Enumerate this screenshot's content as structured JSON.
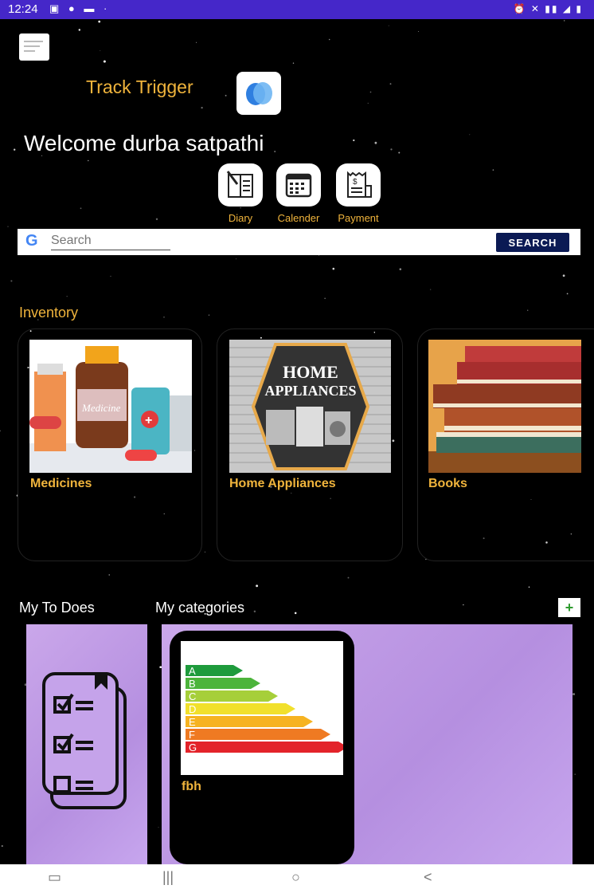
{
  "status_bar": {
    "time": "12:24"
  },
  "header": {
    "app_title": "Track Trigger",
    "welcome": "Welcome durba satpathi"
  },
  "quick_actions": [
    {
      "label": "Diary",
      "icon": "diary-icon"
    },
    {
      "label": "Calender",
      "icon": "calendar-icon"
    },
    {
      "label": "Payment",
      "icon": "payment-receipt-icon"
    }
  ],
  "search": {
    "placeholder": "Search",
    "button_label": "SEARCH"
  },
  "inventory": {
    "title": "Inventory",
    "items": [
      {
        "label": "Medicines",
        "image_text": "Medicine"
      },
      {
        "label": "Home Appliances",
        "image_text_1": "HOME",
        "image_text_2": "APPLIANCES"
      },
      {
        "label": "Books"
      }
    ]
  },
  "todos": {
    "title": "My To Does"
  },
  "categories": {
    "title": "My categories",
    "add_label": "+",
    "items": [
      {
        "label": "fbh",
        "image_letters": [
          "A",
          "B",
          "C",
          "D",
          "E",
          "F",
          "G"
        ]
      }
    ]
  },
  "nav": {
    "recents": "|||",
    "home": "○",
    "back": "<"
  },
  "colors": {
    "accent": "#f0b43c",
    "status_bar": "#4527c9",
    "search_button": "#0b1a54",
    "panel": "#c5a3ea"
  }
}
